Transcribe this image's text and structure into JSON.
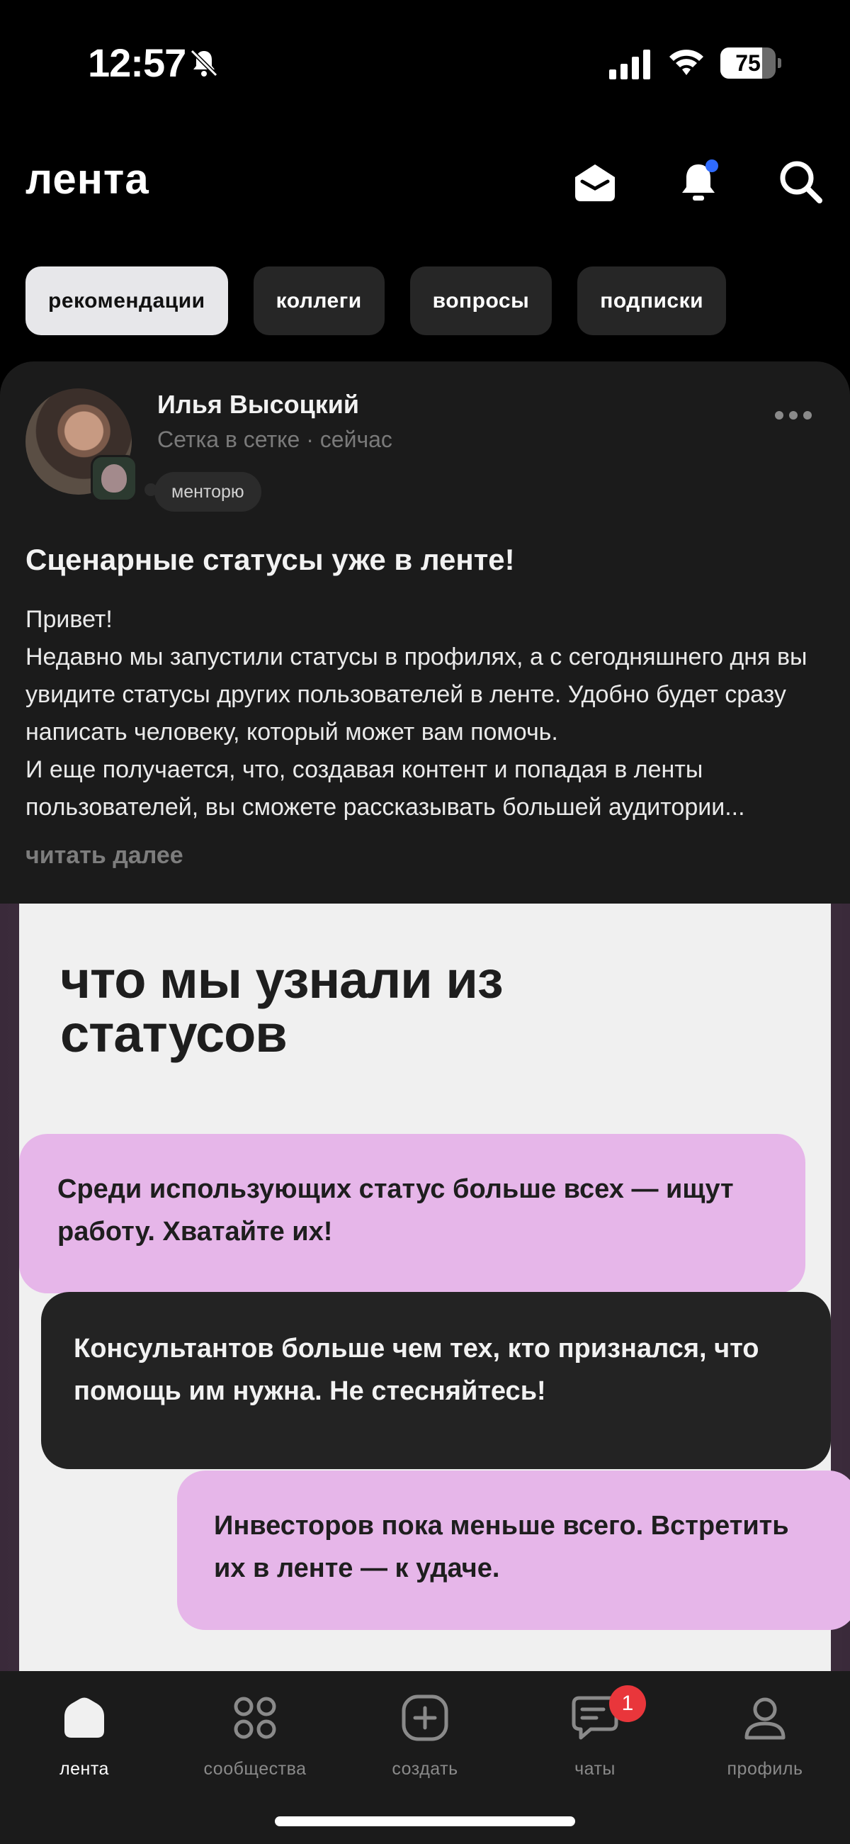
{
  "status_bar": {
    "time": "12:57",
    "battery": "75",
    "battery_level": 0.75
  },
  "header": {
    "title": "лента"
  },
  "tabs": [
    {
      "label": "рекомендации",
      "active": true
    },
    {
      "label": "коллеги"
    },
    {
      "label": "вопросы"
    },
    {
      "label": "подписки"
    }
  ],
  "post": {
    "author": "Илья Высоцкий",
    "meta": "Сетка в сетке · сейчас",
    "status_chip": "менторю",
    "title": "Сценарные статусы уже в ленте!",
    "text": "Привет!\nНедавно мы запустили статусы в профилях, а с сегодняшнего дня вы увидите статусы других пользователей в ленте. Удобно будет сразу написать человеку, который может вам помочь.\nИ еще получается, что, создавая контент и попадая в ленты пользователей, вы сможете рассказывать большей аудитории...",
    "read_more": "читать далее",
    "image": {
      "heading": "что мы узнали из статусов",
      "bubbles": [
        "Среди использующих статус больше всех — ищут работу. Хватайте их!",
        "Консультантов больше чем тех, кто признался, что помощь им нужна. Не стесняйтесь!",
        "Инвесторов пока меньше всего. Встретить их в ленте — к удаче."
      ]
    }
  },
  "bottom_nav": [
    {
      "label": "лента",
      "icon": "home-icon",
      "active": true
    },
    {
      "label": "сообщества",
      "icon": "grid-icon"
    },
    {
      "label": "создать",
      "icon": "plus-square-icon"
    },
    {
      "label": "чаты",
      "icon": "chat-icon",
      "badge": "1"
    },
    {
      "label": "профиль",
      "icon": "profile-icon"
    }
  ],
  "colors": {
    "accent_pink": "#e6b6e9",
    "badge_red": "#e9363b",
    "notif_dot": "#2f6bff"
  }
}
